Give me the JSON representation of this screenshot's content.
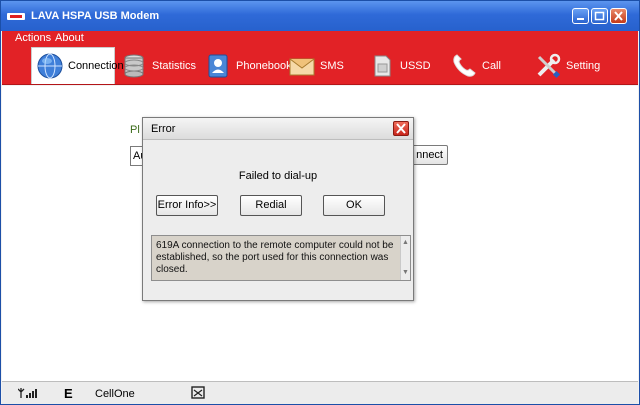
{
  "window": {
    "title": "LAVA HSPA USB Modem"
  },
  "menu": {
    "actions": "Actions",
    "about": "About"
  },
  "toolbar": {
    "tabs": [
      {
        "label": "Connection",
        "icon": "globe-icon"
      },
      {
        "label": "Statistics",
        "icon": "database-icon"
      },
      {
        "label": "Phonebook",
        "icon": "contact-icon"
      },
      {
        "label": "SMS",
        "icon": "envelope-icon"
      },
      {
        "label": "USSD",
        "icon": "sim-icon"
      },
      {
        "label": "Call",
        "icon": "phone-icon"
      },
      {
        "label": "Setting",
        "icon": "tools-icon"
      }
    ]
  },
  "content": {
    "profile_label": "Pl",
    "profile_value": "Au",
    "connect_label": "nnect"
  },
  "dialog": {
    "title": "Error",
    "message": "Failed to dial-up",
    "error_info_label": "Error Info>>",
    "redial_label": "Redial",
    "ok_label": "OK",
    "detail": "619A connection to the remote computer could not be established, so the port used for this connection was closed."
  },
  "status": {
    "network_type": "E",
    "operator": "CellOne"
  },
  "colors": {
    "accent": "#e22226",
    "titlebar": "#2f6ad8"
  }
}
